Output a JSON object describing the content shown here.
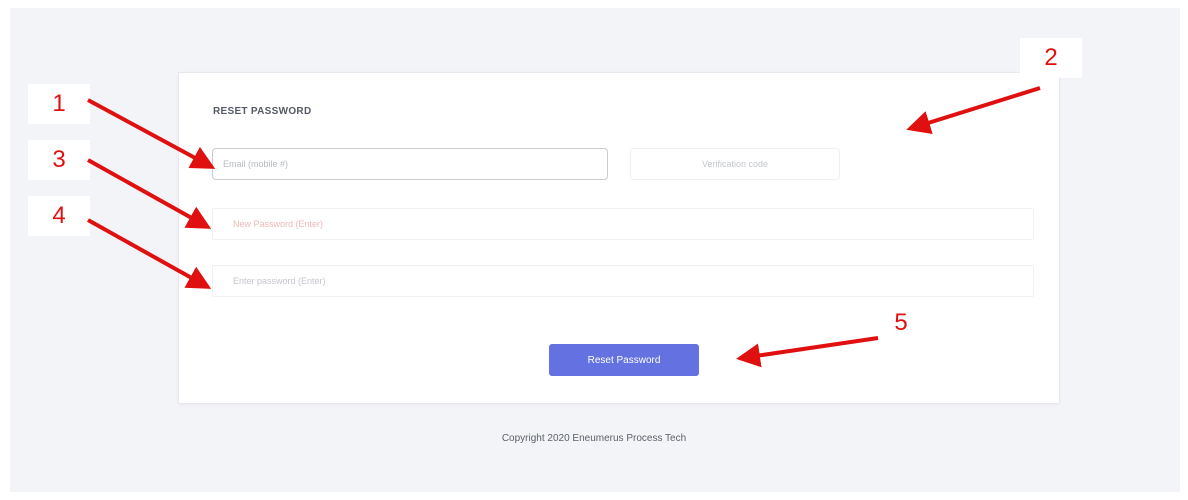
{
  "form": {
    "title": "RESET PASSWORD",
    "email_placeholder": "Email (mobile #)",
    "send_code_label": "Verification code",
    "new_password_placeholder": "New Password (Enter)",
    "confirm_password_placeholder": "Enter password (Enter)",
    "reset_button_label": "Reset Password"
  },
  "footer": {
    "copyright": "Copyright 2020 Eneumerus Process Tech"
  },
  "annotations": {
    "markers": [
      "1",
      "2",
      "3",
      "4",
      "5"
    ],
    "color": "#e01010"
  },
  "colors": {
    "accent": "#6471e0",
    "background": "#f3f4f8"
  }
}
